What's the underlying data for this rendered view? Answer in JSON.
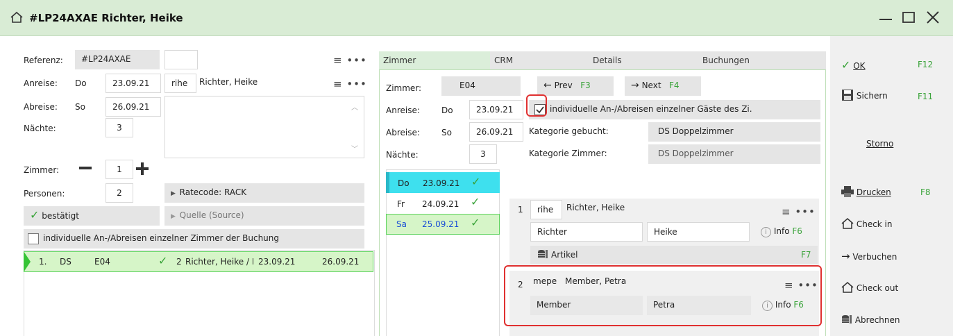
{
  "window": {
    "title": "#LP24AXAE Richter, Heike"
  },
  "left": {
    "referenz_label": "Referenz:",
    "referenz_value": "#LP24AXAE",
    "anreise_label": "Anreise:",
    "anreise_day": "Do",
    "anreise_date": "23.09.21",
    "guest_code": "rihe",
    "guest_name": "Richter, Heike",
    "abreise_label": "Abreise:",
    "abreise_day": "So",
    "abreise_date": "26.09.21",
    "naechte_label": "Nächte:",
    "naechte_value": "3",
    "zimmer_label": "Zimmer:",
    "zimmer_value": "1",
    "personen_label": "Personen:",
    "personen_value": "2",
    "ratecode": "Ratecode: RACK",
    "status": "bestätigt",
    "quelle": "Quelle (Source)",
    "individual_label": "individuelle An-/Abreisen einzelner Zimmer der Buchung",
    "row": {
      "num": "1.",
      "cat": "DS",
      "room": "E04",
      "persons": "2",
      "names": "Richter, Heike / Mer",
      "from": "23.09.21",
      "to": "26.09.21"
    }
  },
  "tabs": [
    "Zimmer",
    "CRM",
    "Details",
    "Buchungen"
  ],
  "middle": {
    "zimmer_label": "Zimmer:",
    "zimmer_value": "E04",
    "prev": "Prev",
    "prev_key": "F3",
    "next": "Next",
    "next_key": "F4",
    "anreise_label": "Anreise:",
    "anreise_day": "Do",
    "anreise_date": "23.09.21",
    "indiv_label": "individuelle An-/Abreisen einzelner Gäste des Zi.",
    "abreise_label": "Abreise:",
    "abreise_day": "So",
    "abreise_date": "26.09.21",
    "kat_gebucht_label": "Kategorie gebucht:",
    "kat_gebucht_value": "DS Doppelzimmer",
    "naechte_label": "Nächte:",
    "naechte_value": "3",
    "kat_zimmer_label": "Kategorie Zimmer:",
    "kat_zimmer_value": "DS Doppelzimmer",
    "days": [
      {
        "day": "Do",
        "date": "23.09.21"
      },
      {
        "day": "Fr",
        "date": "24.09.21"
      },
      {
        "day": "Sa",
        "date": "25.09.21"
      }
    ],
    "guest1": {
      "num": "1",
      "code": "rihe",
      "name": "Richter, Heike",
      "last": "Richter",
      "first": "Heike",
      "info": "Info",
      "info_key": "F6"
    },
    "artikel": "Artikel",
    "artikel_key": "F7",
    "guest2": {
      "num": "2",
      "code": "mepe",
      "name": "Member, Petra",
      "last": "Member",
      "first": "Petra",
      "info": "Info",
      "info_key": "F6"
    }
  },
  "right": {
    "ok": "OK",
    "ok_key": "F12",
    "sichern": "Sichern",
    "sichern_key": "F11",
    "storno": "Storno",
    "drucken": "Drucken",
    "drucken_key": "F8",
    "checkin": "Check in",
    "verbuchen": "Verbuchen",
    "checkout": "Check out",
    "abrechnen": "Abrechnen"
  },
  "colors": {
    "accent_green": "#3aa33a",
    "title_bg": "#d9ecd5",
    "highlight_cyan": "#3ee0ee",
    "selection_green": "#d6f5c8",
    "red_outline": "#e03030"
  }
}
